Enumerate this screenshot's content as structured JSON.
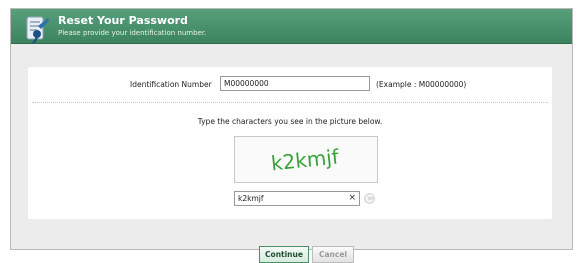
{
  "header": {
    "title": "Reset Your Password",
    "subtitle": "Please provide your identification number."
  },
  "identification": {
    "label": "Identification Number",
    "value": "M00000000",
    "example": "(Example : M00000000)"
  },
  "captcha": {
    "instruction": "Type the characters you see in the picture below.",
    "image_text": "k2kmjf",
    "input_value": "k2kmjf",
    "clear_glyph": "×"
  },
  "buttons": {
    "continue_label": "Continue",
    "cancel_label": "Cancel"
  },
  "colors": {
    "header": "#3f8a64",
    "captcha_text": "#3aa03a"
  }
}
